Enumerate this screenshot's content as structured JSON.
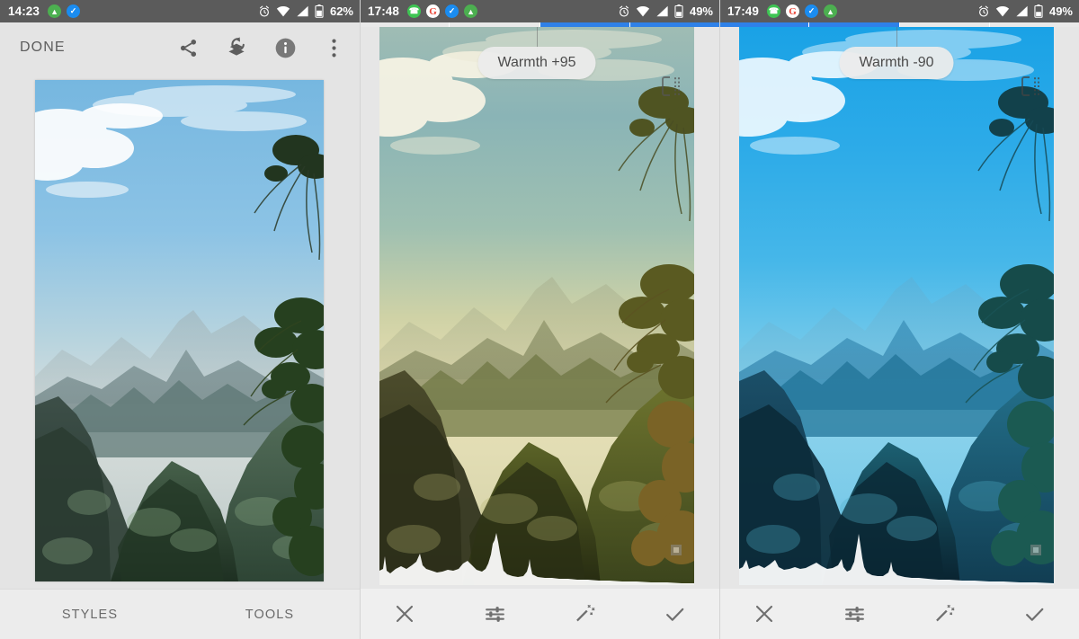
{
  "panels": [
    {
      "id": "editor-home",
      "statusbar": {
        "time": "14:23",
        "left_icons": [
          "vlc-icon",
          "tick-badge-icon"
        ],
        "right_icons": [
          "alarm-icon",
          "wifi-icon",
          "signal-icon",
          "battery-icon"
        ],
        "battery": "62%"
      },
      "toolbar": {
        "done_label": "DONE",
        "icons": [
          "share-icon",
          "stack-revert-icon",
          "info-icon",
          "overflow-menu-icon"
        ]
      },
      "bottom_tabs": [
        {
          "label": "STYLES",
          "name": "tab-styles"
        },
        {
          "label": "TOOLS",
          "name": "tab-tools"
        }
      ],
      "photo": {
        "alt": "mountain valley landscape, natural colors"
      }
    },
    {
      "id": "warmth-plus",
      "statusbar": {
        "time": "17:48",
        "left_icons": [
          "whatsapp-icon",
          "google-icon",
          "tick-badge-icon",
          "vlc-icon"
        ],
        "right_icons": [
          "alarm-icon",
          "wifi-icon",
          "signal-icon",
          "battery-icon"
        ],
        "battery": "49%"
      },
      "adjust_pill": "Warmth +95",
      "compare_icon": "compare-split-icon",
      "progress_segments": [
        false,
        false,
        true,
        true
      ],
      "bottom_buttons": [
        {
          "name": "cancel-button",
          "icon": "close-icon"
        },
        {
          "name": "tune-button",
          "icon": "sliders-icon"
        },
        {
          "name": "auto-enhance-button",
          "icon": "magic-wand-icon"
        },
        {
          "name": "apply-button",
          "icon": "check-icon"
        }
      ],
      "photo": {
        "alt": "mountain valley landscape, warm golden tint"
      }
    },
    {
      "id": "warmth-minus",
      "statusbar": {
        "time": "17:49",
        "left_icons": [
          "whatsapp-icon",
          "google-icon",
          "tick-badge-icon",
          "vlc-icon"
        ],
        "right_icons": [
          "alarm-icon",
          "wifi-icon",
          "signal-icon",
          "battery-icon"
        ],
        "battery": "49%"
      },
      "adjust_pill": "Warmth -90",
      "compare_icon": "compare-split-icon",
      "progress_segments": [
        true,
        true,
        false,
        false
      ],
      "bottom_buttons": [
        {
          "name": "cancel-button",
          "icon": "close-icon"
        },
        {
          "name": "tune-button",
          "icon": "sliders-icon"
        },
        {
          "name": "auto-enhance-button",
          "icon": "magic-wand-icon"
        },
        {
          "name": "apply-button",
          "icon": "check-icon"
        }
      ],
      "photo": {
        "alt": "mountain valley landscape, cool blue tint"
      }
    }
  ],
  "colors": {
    "statusbar_bg": "#5b5b5b",
    "accent_blue": "#2f81e8",
    "chrome_bg": "#e4e4e4",
    "toolbar_text": "#5d5d5d"
  }
}
